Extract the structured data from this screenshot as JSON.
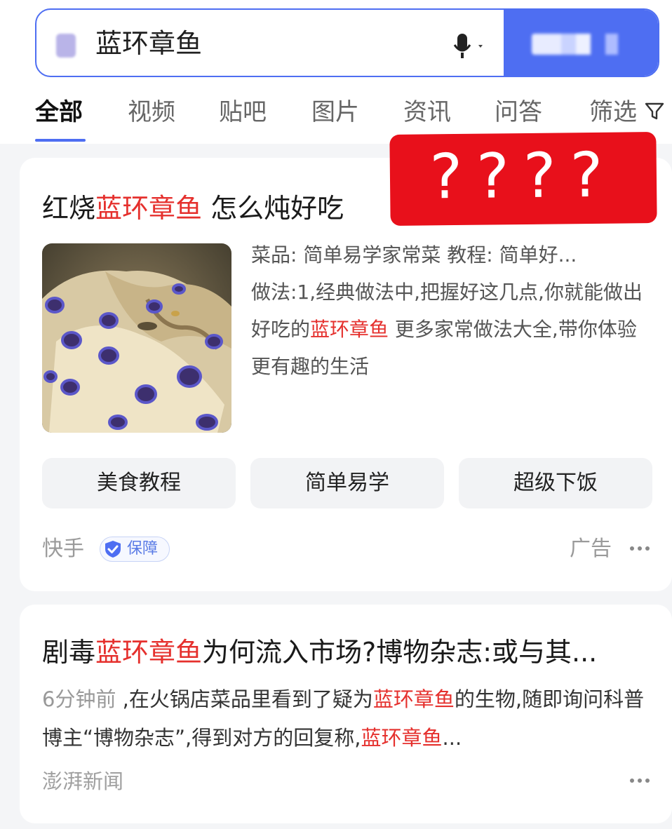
{
  "search": {
    "query": "蓝环章鱼"
  },
  "tabs": [
    {
      "label": "全部"
    },
    {
      "label": "视频"
    },
    {
      "label": "贴吧"
    },
    {
      "label": "图片"
    },
    {
      "label": "资讯"
    },
    {
      "label": "问答"
    },
    {
      "label": "筛选"
    }
  ],
  "overlay": {
    "text": "????",
    "color": "#e8101b"
  },
  "results": [
    {
      "title_prefix": "红烧",
      "title_highlight": "蓝环章鱼",
      "title_suffix": " 怎么炖好吃",
      "meta": "菜品: 简单易学家常菜    教程: 简单好...",
      "desc_prefix": "做法:1,经典做法中,把握好这几点,你就能做出好吃的",
      "desc_highlight": "蓝环章鱼",
      "desc_suffix": " 更多家常做法大全,带你体验更有趣的生活",
      "pills": [
        "美食教程",
        "简单易学",
        "超级下饭"
      ],
      "source": "快手",
      "badge": "保障",
      "ad_label": "广告"
    },
    {
      "title_prefix": "剧毒",
      "title_highlight": "蓝环章鱼",
      "title_suffix": "为何流入市场?博物杂志:或与其...",
      "time": "6分钟前",
      "body_1": " ,在火锅店菜品里看到了疑为",
      "body_hl_1": "蓝环章鱼",
      "body_2": "的生物,随即询问科普博主“博物杂志”,得到对方的回复称,",
      "body_hl_2": "蓝环章鱼",
      "body_3": "...",
      "source": "澎湃新闻"
    }
  ],
  "colors": {
    "accent": "#4e6ef2",
    "highlight": "#e5302d"
  }
}
